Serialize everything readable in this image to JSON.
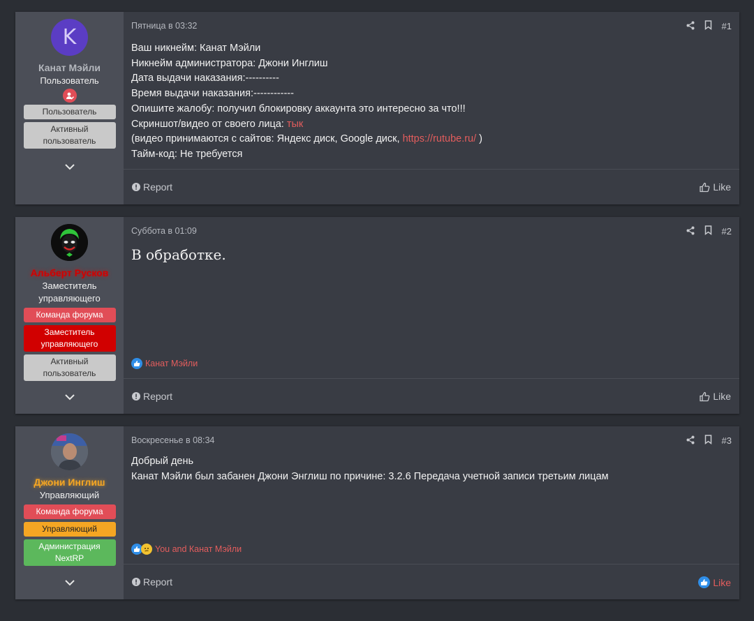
{
  "posts": [
    {
      "user": {
        "avatar_letter": "K",
        "name": "Канат Мэйли",
        "name_color": "#b4b7bd",
        "title": "Пользователь",
        "badges": [
          "Пользователь",
          "Активный пользователь"
        ]
      },
      "date": "Пятница в 03:32",
      "number": "#1",
      "lines": [
        "Ваш никнейм: Канат Мэйли",
        "Никнейм администратора: Джони Инглиш",
        "Дата выдачи наказания:----------",
        "Время выдачи наказания:------------",
        "Опишите жалобу: получил блокировку аккаунта это интересно за что!!!"
      ],
      "screenshot_prefix": "Скриншот/видео от своего лица: ",
      "screenshot_link": "тык",
      "video_prefix": "(видео принимаются с сайтов: Яндекс диск, Google диск, ",
      "video_link": "https://rutube.ru/",
      "video_suffix": " )",
      "timecode": "Тайм-код: Не требуется",
      "report_label": "Report",
      "like_label": "Like"
    },
    {
      "user": {
        "name": "Альберт Русков",
        "name_color": "#d10000",
        "title": "Заместитель управляющего",
        "badges": [
          "Команда форума",
          "Заместитель управляющего",
          "Активный пользователь"
        ]
      },
      "date": "Суббота в 01:09",
      "number": "#2",
      "body": "В обработке.",
      "reactions_text": "Канат Мэйли",
      "report_label": "Report",
      "like_label": "Like"
    },
    {
      "user": {
        "name": "Джони Инглиш",
        "name_color": "#f5a623",
        "title": "Управляющий",
        "badges": [
          "Команда форума",
          "Управляющий",
          "Администрация NextRP"
        ]
      },
      "date": "Воскресенье в 08:34",
      "number": "#3",
      "lines": [
        "Добрый день",
        "Канат Мэйли был забанен Джони Энглиш по причине: 3.2.6 Передача учетной записи третьим лицам"
      ],
      "reactions_text": "You and Канат Мэйли",
      "report_label": "Report",
      "like_label": "Like"
    }
  ]
}
